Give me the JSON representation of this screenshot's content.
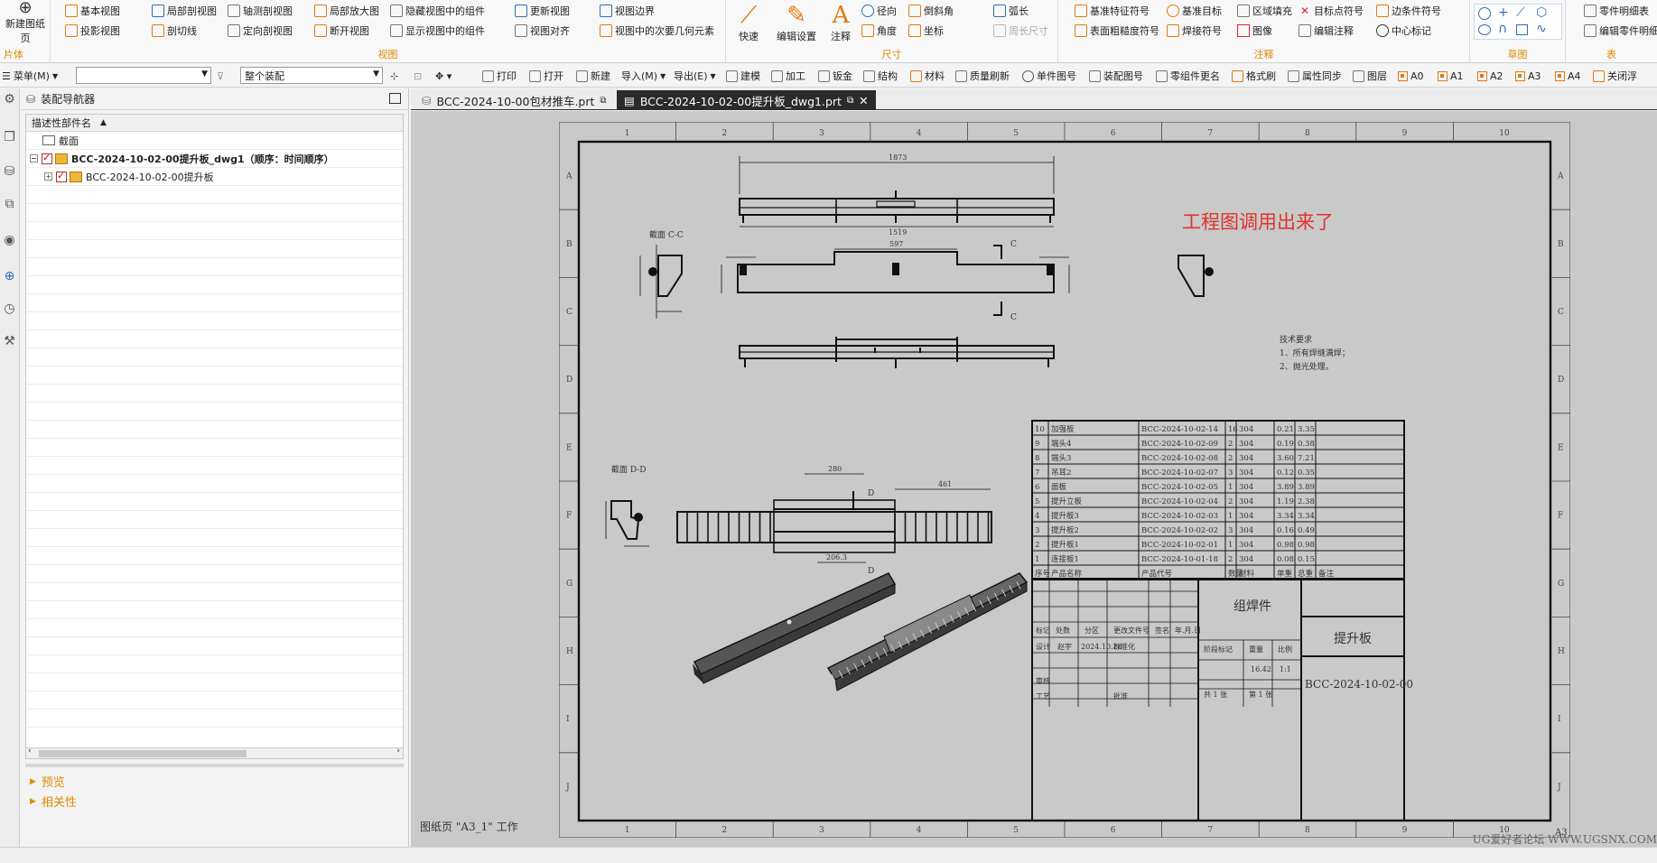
{
  "ribbon": {
    "groups": {
      "sheet": "片体",
      "view": "视图",
      "dimension": "尺寸",
      "annotation": "注释",
      "sketch": "草图",
      "table": "表"
    },
    "new_sheet": "新建图纸页",
    "view_buttons": [
      "基本视图",
      "投影视图",
      "局部剖视图",
      "剖切线",
      "轴测剖视图",
      "定向剖视图",
      "局部放大图",
      "断开视图",
      "隐藏视图中的组件",
      "显示视图中的组件",
      "更新视图",
      "视图对齐",
      "视图边界",
      "视图中的次要几何元素"
    ],
    "quick": "快速",
    "edit_settings": "编辑设置",
    "note": "注释",
    "dim_buttons": [
      "径向",
      "角度",
      "倒斜角",
      "坐标",
      "弧长",
      "周长尺寸"
    ],
    "annot_buttons": [
      "基准特征符号",
      "表面粗糙度符号",
      "基准目标",
      "焊接符号",
      "区域填充",
      "图像",
      "目标点符号",
      "编辑注释",
      "边条件符号",
      "中心标记"
    ],
    "table_buttons": [
      "零件明细表",
      "编辑零件明细"
    ]
  },
  "toolbar": {
    "menu": "菜单(M)",
    "filter_value": "",
    "assembly_scope": "整个装配",
    "items": [
      "打印",
      "打开",
      "新建",
      "导入(M)",
      "导出(E)",
      "建模",
      "加工",
      "钣金",
      "结构",
      "材料",
      "质量刷新",
      "单件图号",
      "装配图号",
      "零组件更名",
      "格式刷",
      "属性同步",
      "图层",
      "A0",
      "A1",
      "A2",
      "A3",
      "A4",
      "关闭浮"
    ]
  },
  "navigator": {
    "title": "装配导航器",
    "column": "描述性部件名",
    "rows": [
      "截面",
      "BCC-2024-10-02-00提升板_dwg1（顺序：时间顺序）",
      "BCC-2024-10-02-00提升板"
    ],
    "preview": "预览",
    "relations": "相关性"
  },
  "tabs": [
    {
      "label": "BCC-2024-10-00包材推车.prt"
    },
    {
      "label": "BCC-2024-10-02-00提升板_dwg1.prt"
    }
  ],
  "drawing": {
    "col_labels": [
      "1",
      "2",
      "3",
      "4",
      "5",
      "6",
      "7",
      "8",
      "9",
      "10"
    ],
    "row_labels": [
      "A",
      "B",
      "C",
      "D",
      "E",
      "F",
      "G",
      "H",
      "I",
      "J"
    ],
    "annotation": "工程图调用出来了",
    "section_cc": "截面 C-C",
    "section_dd": "截面 D-D",
    "cut_c": "C",
    "cut_d": "D",
    "tech_title": "技术要求",
    "tech_1": "1、所有焊缝满焊；",
    "tech_2": "2、抛光处理。",
    "dims": {
      "top_overall": "1873",
      "top_bottom": "1519",
      "front_top": "597",
      "dd_top": "280",
      "dd_right": "461",
      "dd_bottom": "206.3"
    },
    "bom": [
      [
        "10",
        "加强板",
        "BCC-2024-10-02-14",
        "16",
        "304",
        "0.21",
        "3.35"
      ],
      [
        "9",
        "端头4",
        "BCC-2024-10-02-09",
        "2",
        "304",
        "0.19",
        "0.38"
      ],
      [
        "8",
        "端头3",
        "BCC-2024-10-02-08",
        "2",
        "304",
        "3.60",
        "7.21"
      ],
      [
        "7",
        "吊耳2",
        "BCC-2024-10-02-07",
        "3",
        "304",
        "0.12",
        "0.35"
      ],
      [
        "6",
        "面板",
        "BCC-2024-10-02-05",
        "1",
        "304",
        "3.89",
        "3.89"
      ],
      [
        "5",
        "提升立板",
        "BCC-2024-10-02-04",
        "2",
        "304",
        "1.19",
        "2.38"
      ],
      [
        "4",
        "提升板3",
        "BCC-2024-10-02-03",
        "1",
        "304",
        "3.34",
        "3.34"
      ],
      [
        "3",
        "提升板2",
        "BCC-2024-10-02-02",
        "3",
        "304",
        "0.16",
        "0.49"
      ],
      [
        "2",
        "提升板1",
        "BCC-2024-10-02-01",
        "1",
        "304",
        "0.98",
        "0.98"
      ],
      [
        "1",
        "连接板1",
        "BCC-2024-10-01-18",
        "2",
        "304",
        "0.08",
        "0.15"
      ]
    ],
    "bom_header": [
      "序号",
      "产品名称",
      "产品代号",
      "数量",
      "材料",
      "单重",
      "总重",
      "备注"
    ],
    "title_block": {
      "weldment": "组焊件",
      "part_name": "提升板",
      "drawing_no": "BCC-2024-10-02-00",
      "mark": "标记",
      "count": "处数",
      "zone": "分区",
      "change_doc": "更改文件号",
      "sign": "签名",
      "date_lbl": "年.月.日",
      "design": "设计",
      "designer": "赵宇",
      "date": "2024.10.28",
      "standardize": "标准化",
      "stage": "阶段标记",
      "weight_lbl": "重量",
      "scale_lbl": "比例",
      "weight": "16.42",
      "scale": "1:1",
      "review": "审核",
      "process": "工艺",
      "approve": "批准",
      "sheets": "共 1 张",
      "sheet_no": "第 1 张"
    },
    "sheet_size": "A3"
  },
  "status": {
    "sheet_info": "图纸页 \"A3_1\" 工作",
    "watermark": "UG爱好者论坛 WWW.UGSNX.COM"
  }
}
